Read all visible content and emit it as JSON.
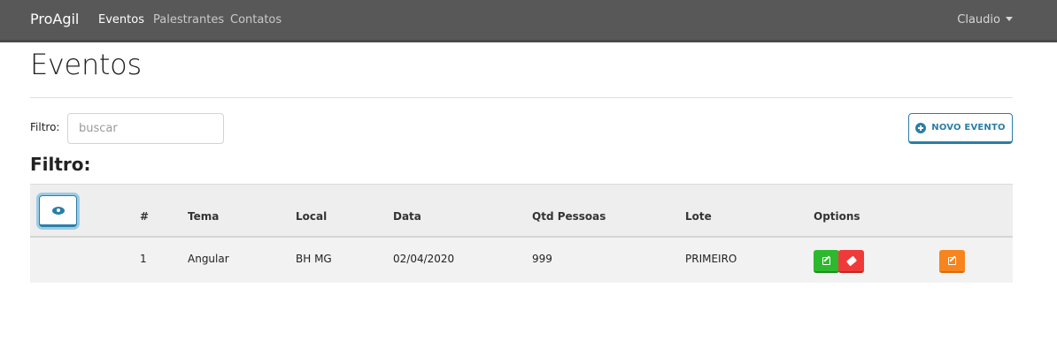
{
  "navbar": {
    "brand": "ProAgil",
    "links": [
      {
        "label": "Eventos"
      },
      {
        "label": "Palestrantes"
      },
      {
        "label": "Contatos"
      }
    ],
    "user": "Claudio"
  },
  "page": {
    "title": "Eventos",
    "filter_label": "Filtro:",
    "filter_placeholder": "buscar",
    "new_button_label": "NOVO EVENTO",
    "subtitle": "Filtro:"
  },
  "table": {
    "columns": [
      "#",
      "Tema",
      "Local",
      "Data",
      "Qtd Pessoas",
      "Lote",
      "Options"
    ],
    "rows": [
      {
        "id": "1",
        "tema": "Angular",
        "local": "BH MG",
        "data": "02/04/2020",
        "qtd": "999",
        "lote": "PRIMEIRO"
      }
    ]
  },
  "colors": {
    "navbar": "#585858",
    "primary": "#2a7ea8",
    "success": "#2eb82e",
    "danger": "#f03a3a",
    "warning": "#f7841d"
  },
  "icons": {
    "eye": "eye-icon",
    "plus": "plus-circle-icon",
    "edit": "edit-icon",
    "eraser": "eraser-icon"
  }
}
